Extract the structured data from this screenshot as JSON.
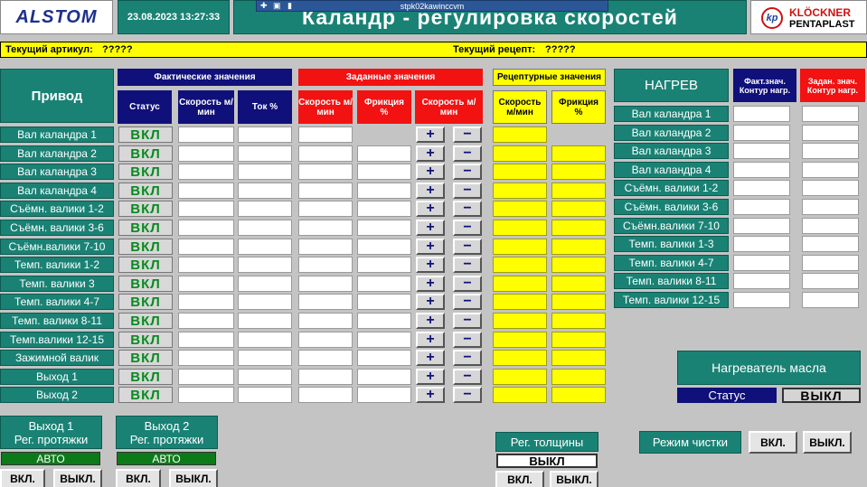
{
  "header": {
    "alstom_logo": "ALSTOM",
    "datetime": "23.08.2023 13:27:33",
    "title": "Каландр - регулировка скоростей",
    "remote_host": "stpk02kawinccvm",
    "kp_logo": "kp",
    "kp_line1": "KLÖCKNER",
    "kp_line2": "PENTAPLAST"
  },
  "info": {
    "article_label": "Текущий артикул:",
    "article_value": "?????",
    "recipe_label": "Текущий рецепт:",
    "recipe_value": "?????"
  },
  "drive_table": {
    "privod": "Привод",
    "group_actual": "Фактические значения",
    "group_setpoint": "Заданные значения",
    "group_recipe": "Рецептурные значения",
    "col_status": "Статус",
    "col_act_speed": "Скорость м/мин",
    "col_current": "Ток %",
    "col_set_speed": "Скорость м/мин",
    "col_set_friction": "Фрикция %",
    "col_set_speed2": "Скорость м/мин",
    "col_rec_speed": "Скорость м/мин",
    "col_rec_friction": "Фрикция %",
    "status_text": "ВКЛ",
    "plus": "+",
    "minus": "−",
    "rows": [
      "Вал каландра 1",
      "Вал каландра 2",
      "Вал каландра 3",
      "Вал каландра 4",
      "Съёмн. валики 1-2",
      "Съёмн. валики 3-6",
      "Съёмн.валики 7-10",
      "Темп. валики 1-2",
      "Темп. валики 3",
      "Темп. валики 4-7",
      "Темп. валики 8-11",
      "Темп.валики 12-15",
      "Зажимной валик",
      "Выход 1",
      "Выход 2"
    ]
  },
  "heating": {
    "title": "НАГРЕВ",
    "col_actual": "Факт.знач. Контур нагр.",
    "col_setpoint": "Задан. знач. Контур нагр.",
    "rows": [
      "Вал каландра 1",
      "Вал каландра 2",
      "Вал каландра 3",
      "Вал каландра 4",
      "Съёмн. валики 1-2",
      "Съёмн. валики 3-6",
      "Съёмн.валики 7-10",
      "Темп. валики 1-3",
      "Темп. валики 4-7",
      "Темп. валики 8-11",
      "Темп. валики 12-15"
    ]
  },
  "oil_heater": {
    "title": "Нагреватель масла",
    "status_label": "Статус",
    "status_value": "ВЫКЛ"
  },
  "bottom": {
    "exit1_line1": "Выход 1",
    "exit1_line2": "Рег. протяжки",
    "exit1_mode": "АВТО",
    "exit2_line1": "Выход 2",
    "exit2_line2": "Рег. протяжки",
    "exit2_mode": "АВТО",
    "on": "ВКЛ.",
    "off": "ВЫКЛ.",
    "thickness_label": "Рег. толщины",
    "thickness_status": "ВЫКЛ",
    "cleaning_label": "Режим чистки"
  },
  "colors": {
    "teal": "#1a8275",
    "navy": "#10107a",
    "red": "#f21212",
    "yellow": "#ffff00",
    "green_status": "#0a8a20"
  }
}
